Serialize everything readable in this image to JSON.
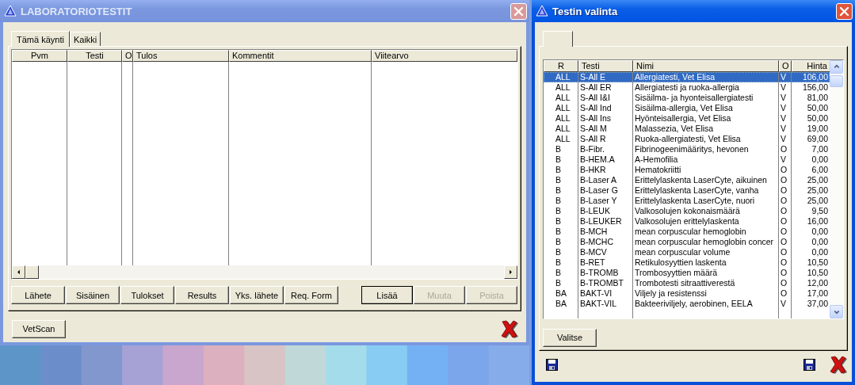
{
  "left_window": {
    "title": "LABORATORIOTESTIT",
    "tabs": [
      {
        "label": "Tämä käynti",
        "selected": true
      },
      {
        "label": "Kaikki",
        "selected": false
      }
    ],
    "table": {
      "columns": [
        "Pvm",
        "Testi",
        "O",
        "Tulos",
        "Kommentit",
        "Viitearvo"
      ]
    },
    "buttons": [
      {
        "label": "Lähete"
      },
      {
        "label": "Sisäinen"
      },
      {
        "label": "Tulokset"
      },
      {
        "label": "Results"
      },
      {
        "label": "Yks. lähete"
      },
      {
        "label": "Req. Form"
      }
    ],
    "action_buttons": [
      {
        "label": "Lisää",
        "default": true,
        "disabled": false
      },
      {
        "label": "Muuta",
        "default": false,
        "disabled": true
      },
      {
        "label": "Poista",
        "default": false,
        "disabled": true
      }
    ],
    "footer_button": "VetScan"
  },
  "right_window": {
    "title": "Testin valinta",
    "table": {
      "columns": [
        "R",
        "Testi",
        "Nimi",
        "O",
        "Hinta"
      ],
      "rows": [
        {
          "r": "ALL",
          "testi": "S-All E",
          "nimi": "Allergiatesti, Vet Elisa",
          "o": "V",
          "hinta": "106,00",
          "selected": true
        },
        {
          "r": "ALL",
          "testi": "S-All ER",
          "nimi": "Allergiatesti ja ruoka-allergia",
          "o": "V",
          "hinta": "156,00",
          "selected": false
        },
        {
          "r": "ALL",
          "testi": "S-All I&I",
          "nimi": "Sisäilma- ja hyonteisallergiatesti",
          "o": "V",
          "hinta": "81,00",
          "selected": false
        },
        {
          "r": "ALL",
          "testi": "S-All Ind",
          "nimi": "Sisäilma-allergia, Vet Elisa",
          "o": "V",
          "hinta": "50,00",
          "selected": false
        },
        {
          "r": "ALL",
          "testi": "S-All Ins",
          "nimi": "Hyönteisallergia, Vet Elisa",
          "o": "V",
          "hinta": "50,00",
          "selected": false
        },
        {
          "r": "ALL",
          "testi": "S-All M",
          "nimi": "Malassezia, Vet Elisa",
          "o": "V",
          "hinta": "19,00",
          "selected": false
        },
        {
          "r": "ALL",
          "testi": "S-All R",
          "nimi": "Ruoka-allergiatesti, Vet Elisa",
          "o": "V",
          "hinta": "69,00",
          "selected": false
        },
        {
          "r": "B",
          "testi": "B-Fibr.",
          "nimi": "Fibrinogeenimääritys, hevonen",
          "o": "O",
          "hinta": "7,00",
          "selected": false
        },
        {
          "r": "B",
          "testi": "B-HEM.A",
          "nimi": "A-Hemofilia",
          "o": "V",
          "hinta": "0,00",
          "selected": false
        },
        {
          "r": "B",
          "testi": "B-HKR",
          "nimi": "Hematokriitti",
          "o": "O",
          "hinta": "6,00",
          "selected": false
        },
        {
          "r": "B",
          "testi": "B-Laser A",
          "nimi": "Erittelylaskenta LaserCyte, aikuinen",
          "o": "O",
          "hinta": "25,00",
          "selected": false
        },
        {
          "r": "B",
          "testi": "B-Laser G",
          "nimi": "Erittelylaskenta LaserCyte, vanha",
          "o": "O",
          "hinta": "25,00",
          "selected": false
        },
        {
          "r": "B",
          "testi": "B-Laser Y",
          "nimi": "Erittelylaskenta LaserCyte, nuori",
          "o": "O",
          "hinta": "25,00",
          "selected": false
        },
        {
          "r": "B",
          "testi": "B-LEUK",
          "nimi": "Valkosolujen kokonaismäärä",
          "o": "O",
          "hinta": "9,50",
          "selected": false
        },
        {
          "r": "B",
          "testi": "B-LEUKER",
          "nimi": "Valkosolujen erittelylaskenta",
          "o": "O",
          "hinta": "16,00",
          "selected": false
        },
        {
          "r": "B",
          "testi": "B-MCH",
          "nimi": "mean corpuscular hemoglobin",
          "o": "O",
          "hinta": "0,00",
          "selected": false
        },
        {
          "r": "B",
          "testi": "B-MCHC",
          "nimi": "mean corpuscular hemoglobin concer",
          "o": "O",
          "hinta": "0,00",
          "selected": false
        },
        {
          "r": "B",
          "testi": "B-MCV",
          "nimi": "mean corpuscular volume",
          "o": "O",
          "hinta": "0,00",
          "selected": false
        },
        {
          "r": "B",
          "testi": "B-RET",
          "nimi": "Retikulosyyttien laskenta",
          "o": "O",
          "hinta": "10,50",
          "selected": false
        },
        {
          "r": "B",
          "testi": "B-TROMB",
          "nimi": "Trombosyyttien määrä",
          "o": "O",
          "hinta": "10,50",
          "selected": false
        },
        {
          "r": "B",
          "testi": "B-TROMBT",
          "nimi": "Trombotesti sitraattiverestä",
          "o": "O",
          "hinta": "12,00",
          "selected": false
        },
        {
          "r": "BA",
          "testi": "BAKT-VI",
          "nimi": "Viljely ja resistenssi",
          "o": "O",
          "hinta": "17,00",
          "selected": false
        },
        {
          "r": "BA",
          "testi": "BAKT-VIL",
          "nimi": "Bakteeriviljely, aerobinen, EELA",
          "o": "V",
          "hinta": "37,00",
          "selected": false
        }
      ]
    },
    "button": "Valitse"
  }
}
